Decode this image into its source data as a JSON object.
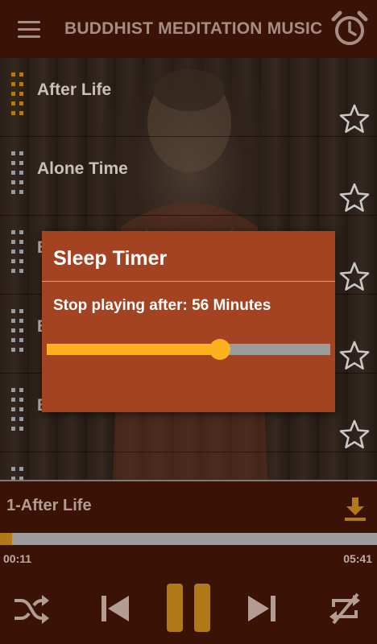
{
  "header": {
    "title": "BUDDHIST MEDITATION MUSIC",
    "menu_icon": "hamburger-menu-icon",
    "timer_icon": "alarm-clock-icon"
  },
  "playlist": {
    "items": [
      {
        "title": "After Life",
        "active": true
      },
      {
        "title": "Alone Time",
        "active": false
      },
      {
        "title": "B",
        "active": false
      },
      {
        "title": "B",
        "active": false
      },
      {
        "title": "B",
        "active": false
      },
      {
        "title": "",
        "active": false
      }
    ]
  },
  "dialog": {
    "title": "Sleep Timer",
    "text": "Stop playing after: 56 Minutes",
    "slider_fraction": 0.61
  },
  "player": {
    "now_playing": "1-After Life",
    "current_time": "00:11",
    "duration": "05:41",
    "progress_fraction": 0.032
  },
  "colors": {
    "header_bg": "#3a1306",
    "dialog_bg": "#a34321",
    "accent": "#fbb21e",
    "active_gold": "#b07a18"
  }
}
